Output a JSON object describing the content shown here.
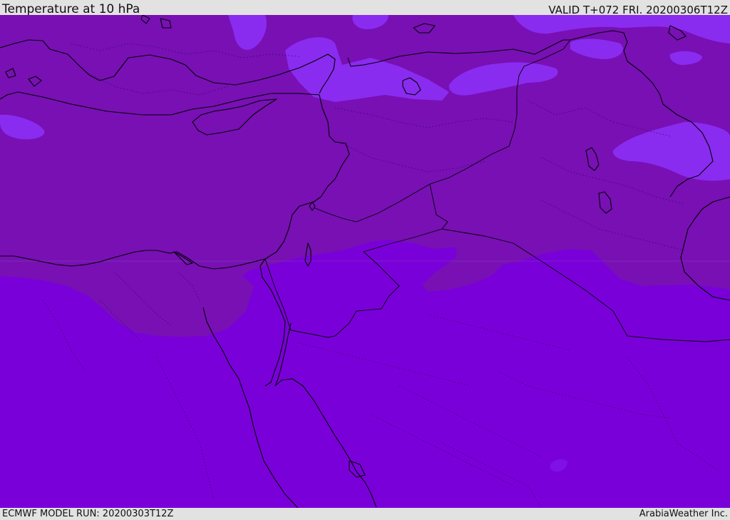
{
  "header": {
    "title": "Temperature at 10 hPa",
    "valid": "VALID T+072 FRI. 20200306T12Z"
  },
  "footer": {
    "model_run": "ECMWF MODEL RUN: 20200303T12Z",
    "credit": "ArabiaWeather Inc."
  },
  "map": {
    "colors": {
      "cold_zone": "#7810b4",
      "warm_zone": "#7a00d9",
      "pocket": "#8a2bf0",
      "coastline": "#000000"
    }
  }
}
